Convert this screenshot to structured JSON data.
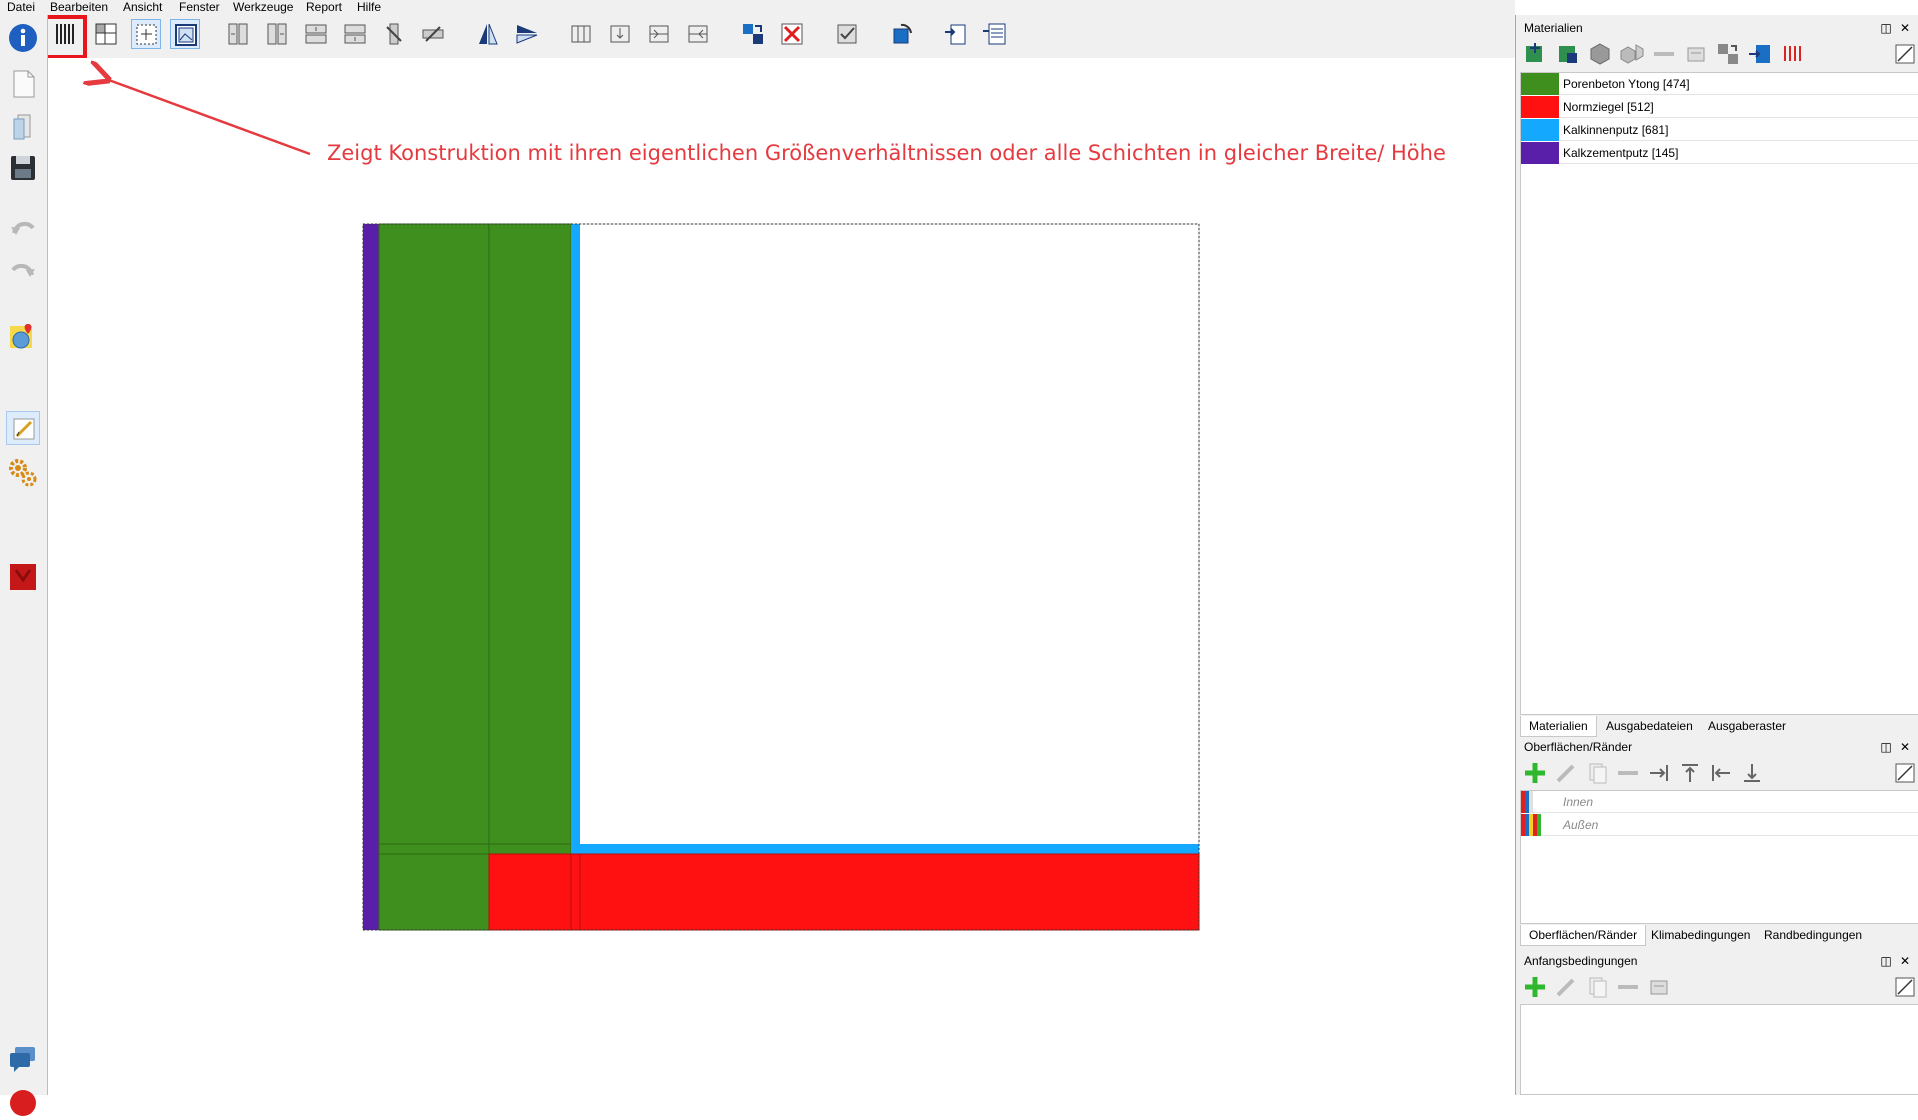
{
  "menu": [
    "Datei",
    "Bearbeiten",
    "Ansicht",
    "Fenster",
    "Werkzeuge",
    "Report",
    "Hilfe"
  ],
  "annotation": "Zeigt Konstruktion mit ihren eigentlichen Größenverhältnissen oder alle Schichten in gleicher Breite/ Höhe",
  "colors": {
    "annotation": "#e53a3f",
    "porenbeton": "#3f8f1e",
    "normziegel": "#ff1111",
    "kalkinnenputz": "#14a8ff",
    "kalkzementputz": "#5a1fa8"
  },
  "panels": {
    "materials": {
      "title": "Materialien",
      "items": [
        {
          "label": "Porenbeton Ytong [474]",
          "color": "#3f8f1e"
        },
        {
          "label": "Normziegel [512]",
          "color": "#ff1111"
        },
        {
          "label": "Kalkinnenputz [681]",
          "color": "#14a8ff"
        },
        {
          "label": "Kalkzementputz [145]",
          "color": "#5a1fa8"
        }
      ],
      "tabs": [
        "Materialien",
        "Ausgabedateien",
        "Ausgaberaster"
      ]
    },
    "surfaces": {
      "title": "Oberflächen/Ränder",
      "items": [
        {
          "label": "Innen"
        },
        {
          "label": "Außen"
        }
      ],
      "tabs": [
        "Oberflächen/Ränder",
        "Klimabedingungen",
        "Randbedingungen"
      ]
    },
    "initial": {
      "title": "Anfangsbedingungen"
    }
  }
}
